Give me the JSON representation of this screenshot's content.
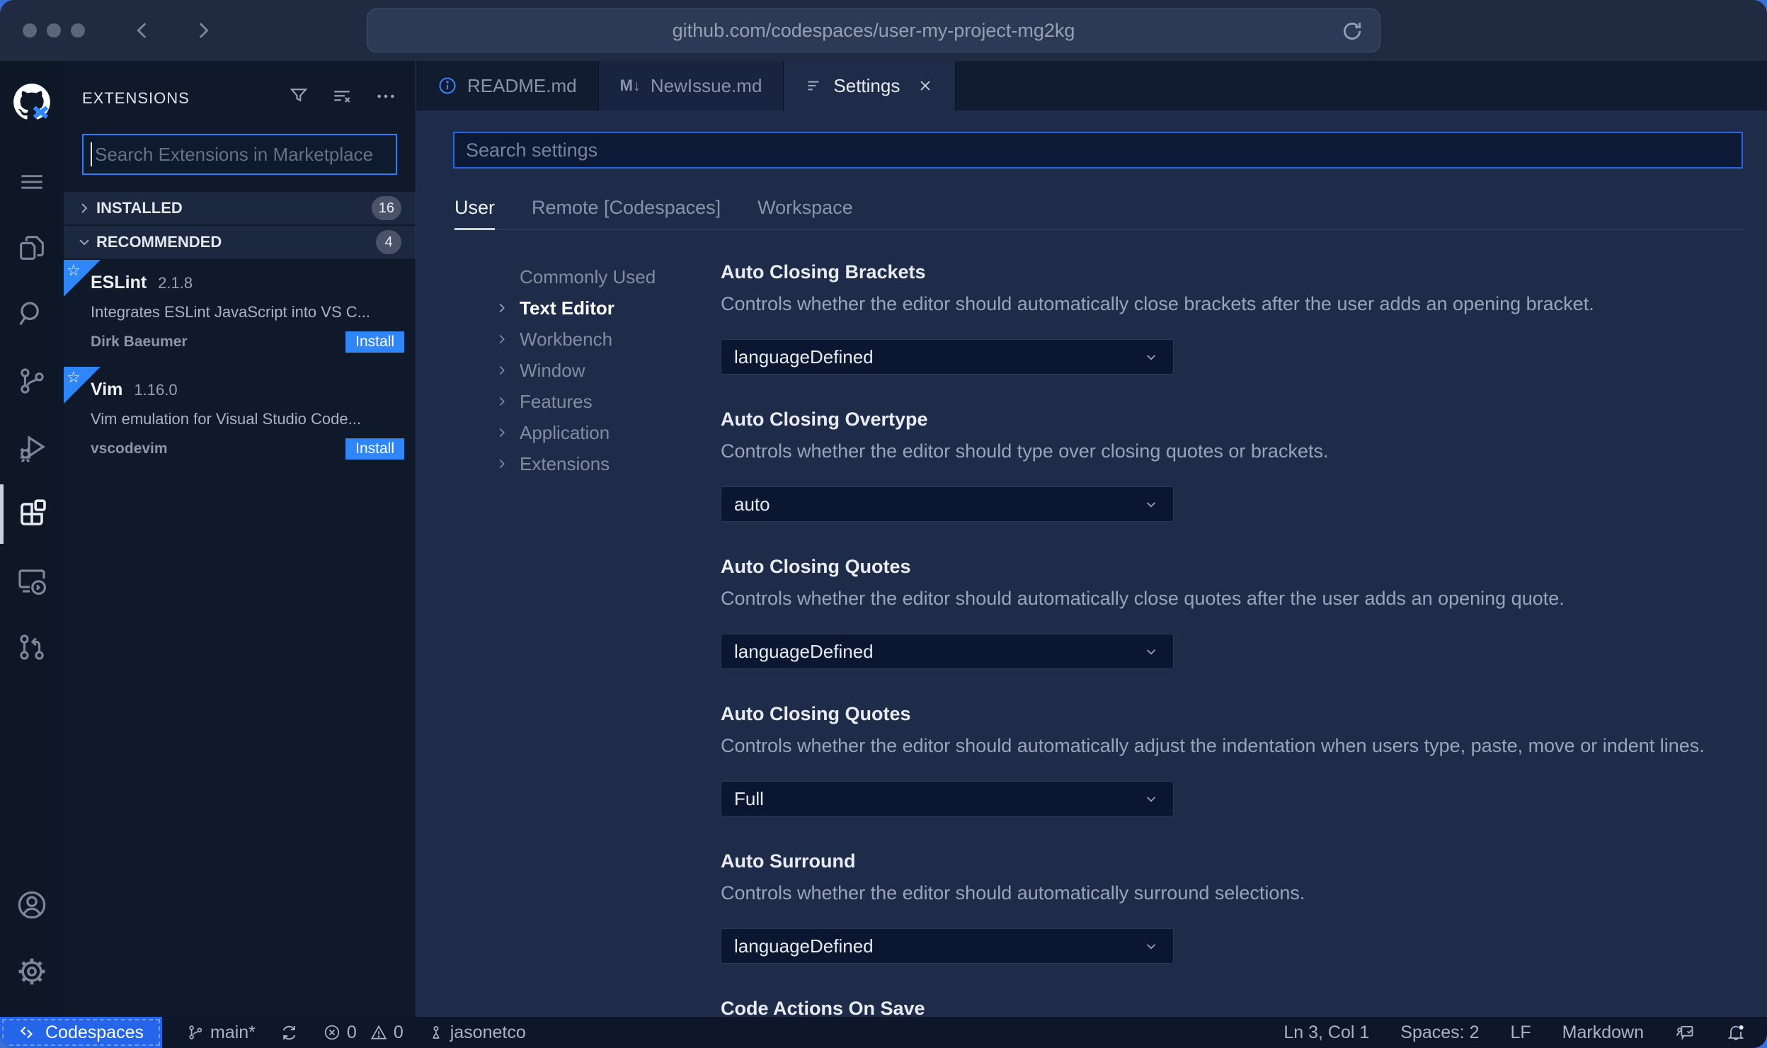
{
  "browser": {
    "url": "github.com/codespaces/user-my-project-mg2kg"
  },
  "extensions_panel": {
    "title": "EXTENSIONS",
    "search_placeholder": "Search Extensions in Marketplace",
    "search_value": "",
    "sections": [
      {
        "label": "INSTALLED",
        "count": "16",
        "state": "collapsed"
      },
      {
        "label": "RECOMMENDED",
        "count": "4",
        "state": "expanded"
      }
    ],
    "items": [
      {
        "name": "ESLint",
        "version": "2.1.8",
        "description": "Integrates ESLint JavaScript into VS C...",
        "publisher": "Dirk Baeumer",
        "action": "Install"
      },
      {
        "name": "Vim",
        "version": "1.16.0",
        "description": "Vim emulation for Visual Studio Code...",
        "publisher": "vscodevim",
        "action": "Install"
      }
    ]
  },
  "tabs": [
    {
      "label": "README.md"
    },
    {
      "label": "NewIssue.md",
      "icon_glyph": "M↓"
    },
    {
      "label": "Settings",
      "active": true
    }
  ],
  "settings": {
    "search_placeholder": "Search settings",
    "search_value": "",
    "scopes": [
      {
        "label": "User",
        "active": true
      },
      {
        "label": "Remote [Codespaces]",
        "active": false
      },
      {
        "label": "Workspace",
        "active": false
      }
    ],
    "tree": [
      {
        "label": "Commonly Used",
        "chevron": false,
        "active": false
      },
      {
        "label": "Text Editor",
        "chevron": true,
        "active": true
      },
      {
        "label": "Workbench",
        "chevron": true,
        "active": false
      },
      {
        "label": "Window",
        "chevron": true,
        "active": false
      },
      {
        "label": "Features",
        "chevron": true,
        "active": false
      },
      {
        "label": "Application",
        "chevron": true,
        "active": false
      },
      {
        "label": "Extensions",
        "chevron": true,
        "active": false
      }
    ],
    "entries": [
      {
        "title": "Auto Closing Brackets",
        "description": "Controls whether the editor should automatically close brackets after the user adds an opening bracket.",
        "value": "languageDefined"
      },
      {
        "title": "Auto Closing Overtype",
        "description": "Controls whether the editor should type over closing quotes or brackets.",
        "value": "auto"
      },
      {
        "title": "Auto Closing Quotes",
        "description": "Controls whether the editor should automatically close quotes after the user adds an opening quote.",
        "value": "languageDefined"
      },
      {
        "title": "Auto Closing Quotes",
        "description": "Controls whether the editor should automatically adjust the indentation when users type, paste, move or indent lines.",
        "value": "Full"
      },
      {
        "title": "Auto Surround",
        "description": "Controls whether the editor should automatically surround selections.",
        "value": "languageDefined"
      },
      {
        "title": "Code Actions On Save"
      }
    ]
  },
  "status_bar": {
    "codespaces_label": "Codespaces",
    "branch": "main*",
    "errors": "0",
    "warnings": "0",
    "user": "jasonetco",
    "line_col": "Ln 3, Col 1",
    "indentation": "Spaces: 2",
    "eol": "LF",
    "language": "Markdown"
  },
  "colors": {
    "accent_blue": "#2f86f8",
    "focus_border": "#2465e9",
    "codespaces_bg": "#2465e9",
    "editor_bg": "#1f2c49",
    "sidebar_bg": "#0f1929",
    "topbar_bg": "#202b42"
  }
}
